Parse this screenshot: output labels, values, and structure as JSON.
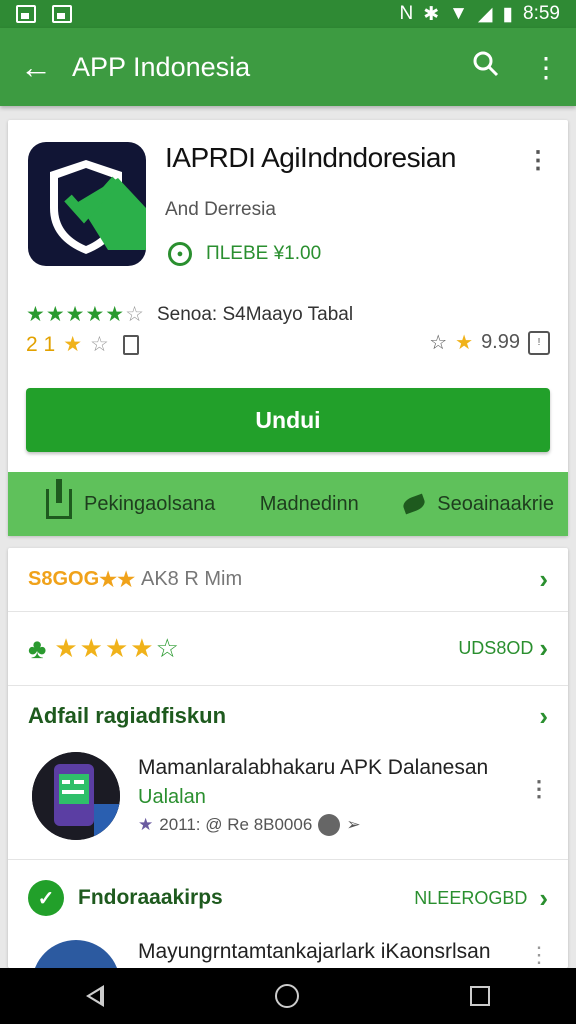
{
  "status_bar": {
    "time": "8:59"
  },
  "app_bar": {
    "title": "APP Indonesia"
  },
  "app": {
    "name": "IAPRDI AgiIndndoresian",
    "developer": "And Derresia",
    "price_label": "ΠLEBE ¥1.00",
    "rating_text": "Senoa: S4Maayo Tabal",
    "rating_count": "2 1",
    "rating_right": "9.99",
    "install_label": "Undui"
  },
  "actions": [
    {
      "label": "Pekingaolsana",
      "icon": "share-icon"
    },
    {
      "label": "Madnedinn",
      "icon": "none"
    },
    {
      "label": "Seoainaakrie",
      "icon": "leaf-icon"
    }
  ],
  "rows": {
    "rating_summary_gold": "S8GOG",
    "rating_summary_text": "AK8 R Mim",
    "stars_link": "UDS8OD",
    "section_title": "Adfail ragiadfiskun",
    "entry1": {
      "title": "Mamanlaralabhakaru APK Dalanesan",
      "subtitle": "Ualalan",
      "meta": "2011: @ Re 8B0006"
    },
    "section2_title": "Fndoraaakirps",
    "section2_right": "NLEEROGBD",
    "entry2": {
      "title": "Mayungrntamtankajarlark iKaonsrlsan"
    }
  },
  "colors": {
    "primary": "#3d9b41",
    "status": "#2f8a34",
    "accent_green": "#22a02a",
    "strip_green": "#5fc15b",
    "star_gold": "#f0b21a"
  }
}
